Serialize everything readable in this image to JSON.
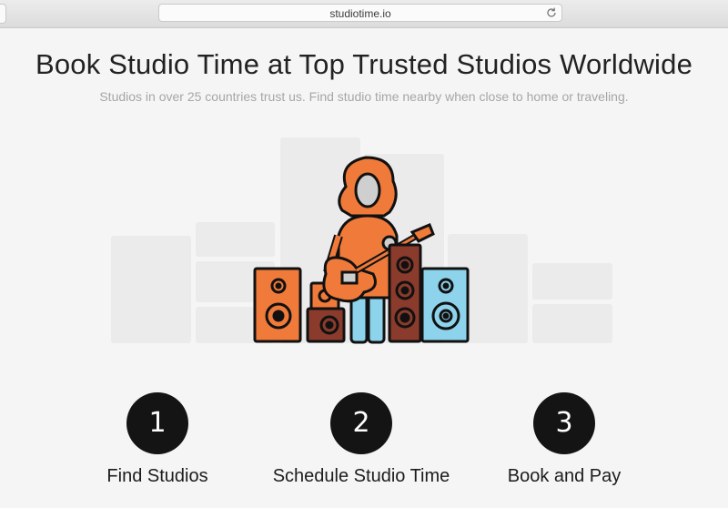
{
  "browser": {
    "url": "studiotime.io",
    "reload_icon": "reload-icon"
  },
  "hero": {
    "title": "Book Studio Time at Top Trusted Studios Worldwide",
    "subtitle": "Studios in over 25 countries trust us. Find studio time nearby when close to home or traveling."
  },
  "illustration": {
    "icon": "guitarist-with-speakers-illustration",
    "colors": {
      "hair": "#f07a3a",
      "outline": "#111111",
      "speaker_orange": "#f07a3a",
      "speaker_brown": "#8a3b2c",
      "speaker_blue": "#8ed3ec",
      "skin": "#cfcfcf",
      "background_blocks": "#ebebeb"
    }
  },
  "steps": [
    {
      "number": "1",
      "label": "Find Studios"
    },
    {
      "number": "2",
      "label": "Schedule Studio Time"
    },
    {
      "number": "3",
      "label": "Book and Pay"
    }
  ]
}
